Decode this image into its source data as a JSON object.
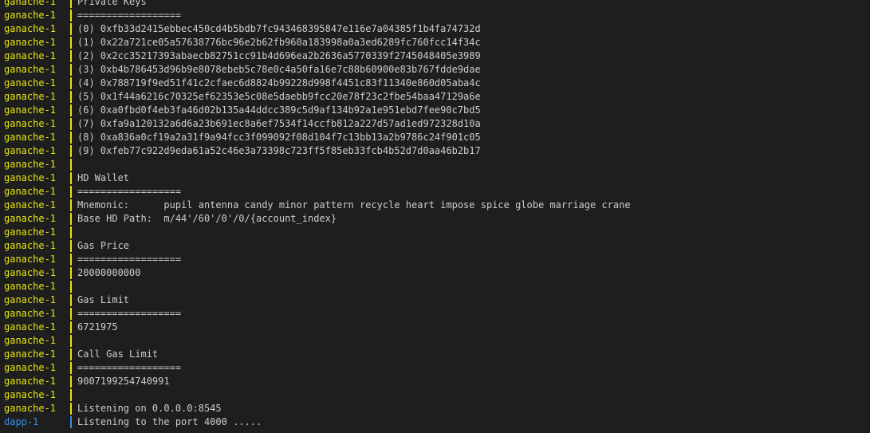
{
  "colors": {
    "background": "#1e1e1e",
    "text": "#cccccc",
    "ganache_prefix": "#e5e510",
    "dapp_prefix": "#3b8eea"
  },
  "lines": [
    {
      "service": "ganache-1",
      "kind": "ganache",
      "text": "Private Keys"
    },
    {
      "service": "ganache-1",
      "kind": "ganache",
      "text": "=================="
    },
    {
      "service": "ganache-1",
      "kind": "ganache",
      "text": "(0) 0xfb33d2415ebbec450cd4b5bdb7fc943468395847e116e7a04385f1b4fa74732d"
    },
    {
      "service": "ganache-1",
      "kind": "ganache",
      "text": "(1) 0x22a721ce05a57638776bc96e2b62fb960a183998a0a3ed6289fc760fcc14f34c"
    },
    {
      "service": "ganache-1",
      "kind": "ganache",
      "text": "(2) 0x2cc35217393abaecb82751cc91b4d696ea2b2636a5770339f2745048405e3989"
    },
    {
      "service": "ganache-1",
      "kind": "ganache",
      "text": "(3) 0xb4b786453d96b9e8078ebeb5c78e0c4a50fa16e7c88b60900e83b767fdde9dae"
    },
    {
      "service": "ganache-1",
      "kind": "ganache",
      "text": "(4) 0x788719f9ed51f41c2cfaec6d8824b99228d998f4451c83f11340e860d05aba4c"
    },
    {
      "service": "ganache-1",
      "kind": "ganache",
      "text": "(5) 0x1f44a6216c70325ef62353e5c08e5daebb9fcc20e78f23c2fbe54baa47129a6e"
    },
    {
      "service": "ganache-1",
      "kind": "ganache",
      "text": "(6) 0xa0fbd0f4eb3fa46d02b135a44ddcc389c5d9af134b92a1e951ebd7fee90c7bd5"
    },
    {
      "service": "ganache-1",
      "kind": "ganache",
      "text": "(7) 0xfa9a120132a6d6a23b691ec8a6ef7534f14ccfb812a227d57ad1ed972328d10a"
    },
    {
      "service": "ganache-1",
      "kind": "ganache",
      "text": "(8) 0xa836a0cf19a2a31f9a94fcc3f099092f08d104f7c13bb13a2b9786c24f901c05"
    },
    {
      "service": "ganache-1",
      "kind": "ganache",
      "text": "(9) 0xfeb77c922d9eda61a52c46e3a73398c723ff5f85eb33fcb4b52d7d0aa46b2b17"
    },
    {
      "service": "ganache-1",
      "kind": "ganache",
      "text": ""
    },
    {
      "service": "ganache-1",
      "kind": "ganache",
      "text": "HD Wallet"
    },
    {
      "service": "ganache-1",
      "kind": "ganache",
      "text": "=================="
    },
    {
      "service": "ganache-1",
      "kind": "ganache",
      "text": "Mnemonic:      pupil antenna candy minor pattern recycle heart impose spice globe marriage crane"
    },
    {
      "service": "ganache-1",
      "kind": "ganache",
      "text": "Base HD Path:  m/44'/60'/0'/0/{account_index}"
    },
    {
      "service": "ganache-1",
      "kind": "ganache",
      "text": ""
    },
    {
      "service": "ganache-1",
      "kind": "ganache",
      "text": "Gas Price"
    },
    {
      "service": "ganache-1",
      "kind": "ganache",
      "text": "=================="
    },
    {
      "service": "ganache-1",
      "kind": "ganache",
      "text": "20000000000"
    },
    {
      "service": "ganache-1",
      "kind": "ganache",
      "text": ""
    },
    {
      "service": "ganache-1",
      "kind": "ganache",
      "text": "Gas Limit"
    },
    {
      "service": "ganache-1",
      "kind": "ganache",
      "text": "=================="
    },
    {
      "service": "ganache-1",
      "kind": "ganache",
      "text": "6721975"
    },
    {
      "service": "ganache-1",
      "kind": "ganache",
      "text": ""
    },
    {
      "service": "ganache-1",
      "kind": "ganache",
      "text": "Call Gas Limit"
    },
    {
      "service": "ganache-1",
      "kind": "ganache",
      "text": "=================="
    },
    {
      "service": "ganache-1",
      "kind": "ganache",
      "text": "9007199254740991"
    },
    {
      "service": "ganache-1",
      "kind": "ganache",
      "text": ""
    },
    {
      "service": "ganache-1",
      "kind": "ganache",
      "text": "Listening on 0.0.0.0:8545"
    },
    {
      "service": "dapp-1",
      "kind": "dapp",
      "text": "Listening to the port 4000 ....."
    }
  ]
}
